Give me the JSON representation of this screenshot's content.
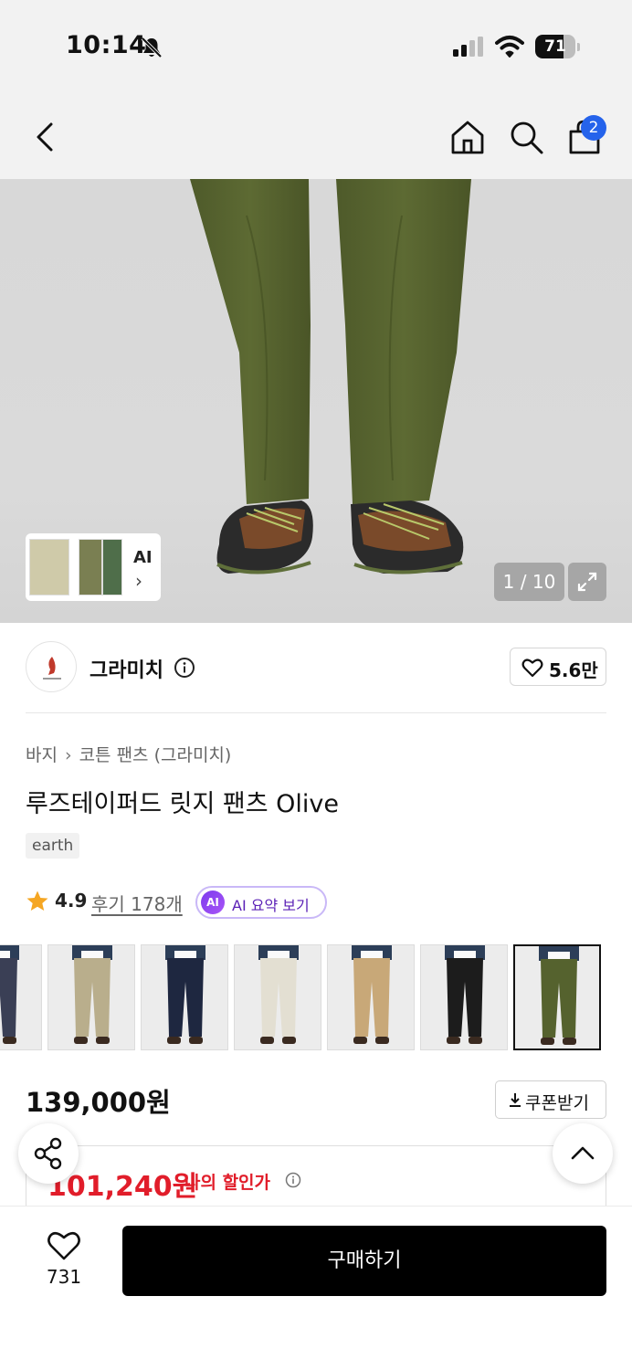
{
  "status_bar": {
    "time": "10:14",
    "battery": "71",
    "battery_level": 0.71,
    "icons": [
      "bell-slash-icon",
      "cellular-signal-icon",
      "wifi-icon",
      "battery-icon"
    ]
  },
  "nav": {
    "icons": [
      "back-chevron-icon",
      "home-icon",
      "search-icon",
      "shopping-bag-icon"
    ],
    "cart_badge": "2",
    "badge_color": "#2563eb"
  },
  "gallery": {
    "ai_label": "AI",
    "ai_chevron": "›",
    "counter": "1 / 10",
    "icons": [
      "expand-icon",
      "ai-chevron-icon"
    ]
  },
  "brand": {
    "name": "그라미치",
    "likes": "5.6만",
    "icons": [
      "info-icon",
      "heart-icon"
    ]
  },
  "product": {
    "breadcrumb": [
      "바지",
      "코튼 팬츠 (그라미치)"
    ],
    "breadcrumb_separator": "›",
    "title": "루즈테이퍼드 릿지 팬츠 Olive",
    "tag": "earth",
    "rating": "4.9",
    "reviews": "후기 178개",
    "ai_badge": "AI",
    "ai_summary": "AI 요약 보기",
    "icons": [
      "star-icon"
    ]
  },
  "variants": {
    "colors": [
      "#3a3f55",
      "#b9ae8c",
      "#1e2740",
      "#e3dfd2",
      "#c8a878",
      "#1c1c1c",
      "#55622e"
    ],
    "selected_index": 6
  },
  "price": {
    "original": "139,000원",
    "coupon": "쿠폰받기",
    "discounted": "101,240원",
    "discount_label": "나의 할인가",
    "discount_color": "#e11d2a",
    "icons": [
      "download-icon",
      "info-icon"
    ]
  },
  "fabs": {
    "icons": [
      "share-icon",
      "scroll-top-icon"
    ]
  },
  "bottom_bar": {
    "wish_count": "731",
    "buy_label": "구매하기",
    "icons": [
      "heart-icon"
    ]
  },
  "colors": {
    "pants_olive": "#55622e",
    "accent_purple": "#7c3aed",
    "buy_button": "#000000"
  }
}
